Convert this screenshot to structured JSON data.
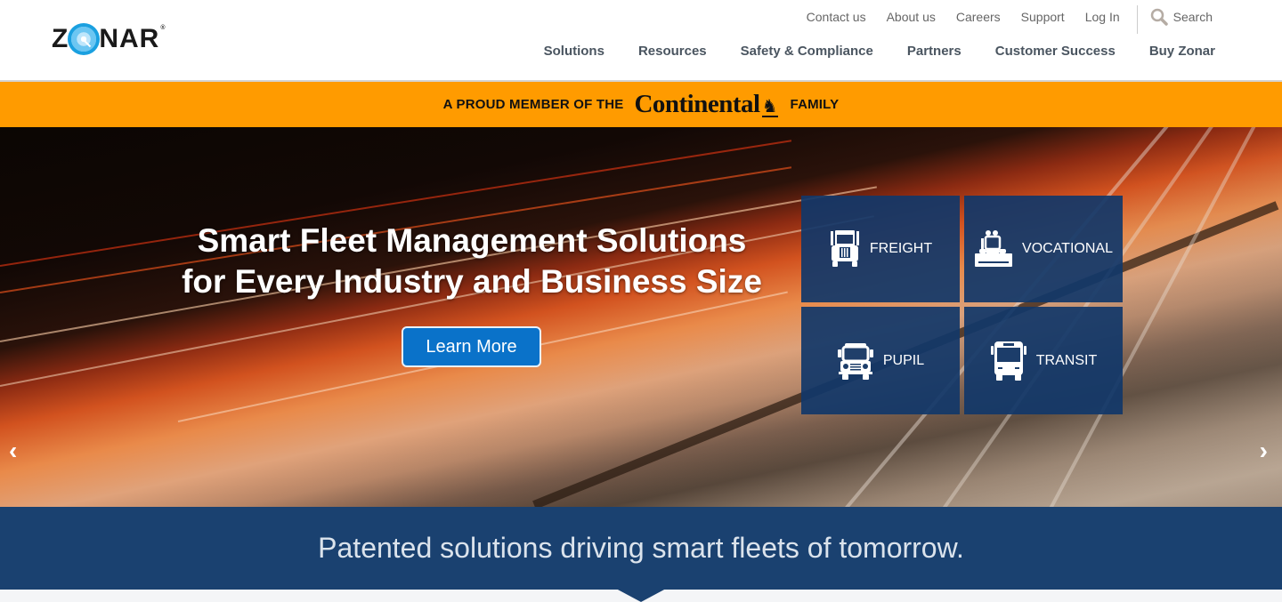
{
  "brand": {
    "logo_text_left": "Z",
    "logo_text_right": "NAR",
    "registered": "®"
  },
  "utility_nav": {
    "links": [
      "Contact us",
      "About us",
      "Careers",
      "Support",
      "Log In"
    ],
    "search_label": "Search"
  },
  "main_nav": {
    "items": [
      "Solutions",
      "Resources",
      "Safety & Compliance",
      "Partners",
      "Customer Success",
      "Buy Zonar"
    ]
  },
  "continental_bar": {
    "prefix": "A PROUD MEMBER OF THE",
    "brand": "Continental",
    "suffix": "FAMILY",
    "background": "#ff9b00"
  },
  "hero": {
    "headline_line1": "Smart Fleet Management Solutions",
    "headline_line2": "for Every Industry and Business Size",
    "cta_label": "Learn More",
    "cta_color": "#0a72c9",
    "prev_icon": "‹",
    "next_icon": "›",
    "tiles": [
      {
        "label": "FREIGHT",
        "icon": "semi-truck-icon"
      },
      {
        "label": "VOCATIONAL",
        "icon": "plow-truck-icon"
      },
      {
        "label": "PUPIL",
        "icon": "school-bus-icon"
      },
      {
        "label": "TRANSIT",
        "icon": "transit-bus-icon"
      }
    ]
  },
  "banner": {
    "text": "Patented solutions driving smart fleets of tomorrow.",
    "background": "#1a4170"
  }
}
